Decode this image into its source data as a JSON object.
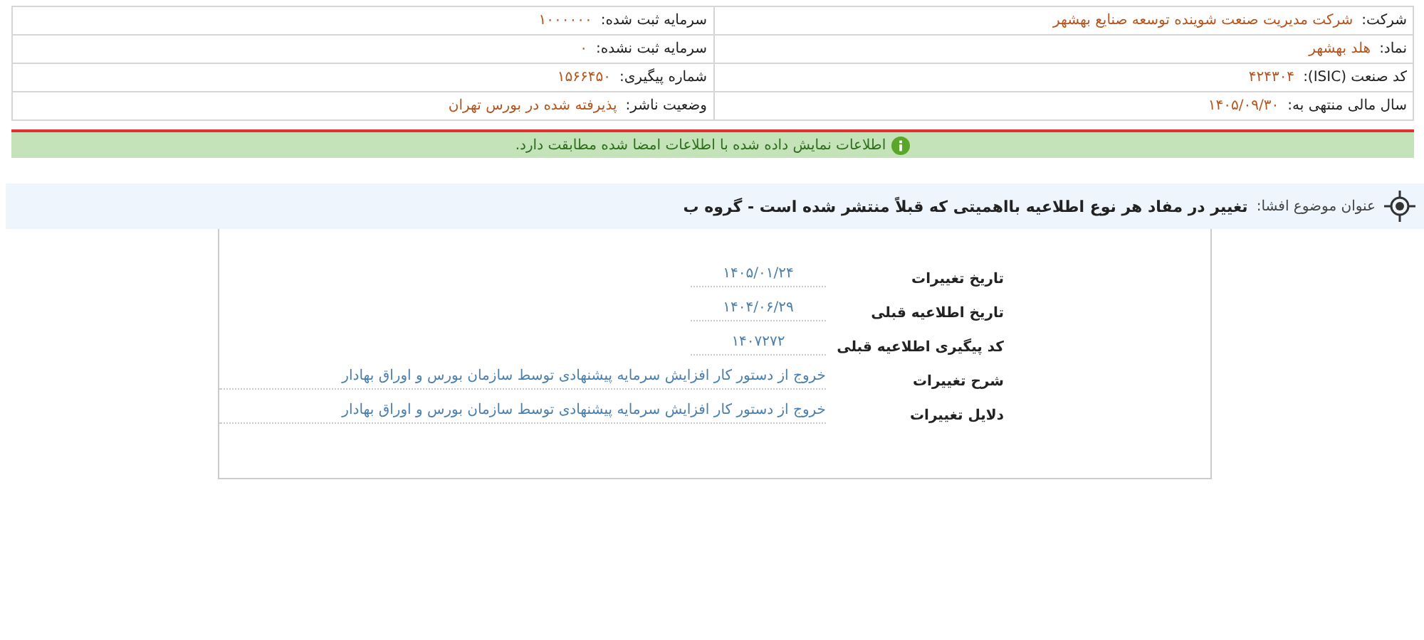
{
  "info_table": {
    "rows": [
      {
        "right": {
          "label": "شرکت:",
          "value": "شرکت مدیریت صنعت شوینده توسعه صنایع بهشهر"
        },
        "left": {
          "label": "سرمایه ثبت شده:",
          "value": "۱۰۰۰۰۰۰"
        }
      },
      {
        "right": {
          "label": "نماد:",
          "value": "هلد بهشهر"
        },
        "left": {
          "label": "سرمایه ثبت نشده:",
          "value": "۰"
        }
      },
      {
        "right": {
          "label": "کد صنعت (ISIC):",
          "value": "۴۲۴۳۰۴"
        },
        "left": {
          "label": "شماره پیگیری:",
          "value": "۱۵۶۶۴۵۰"
        }
      },
      {
        "right": {
          "label": "سال مالی منتهی به:",
          "value": "۱۴۰۵/۰۹/۳۰"
        },
        "left": {
          "label": "وضعیت ناشر:",
          "value": "پذیرفته شده در بورس تهران"
        }
      }
    ]
  },
  "notice": {
    "text": "اطلاعات نمایش داده شده با اطلاعات امضا شده مطابقت دارد."
  },
  "disclosure": {
    "subject_label": "عنوان موضوع افشا:",
    "subject": "تغییر در مفاد هر نوع اطلاعیه بااهمیتی که قبلاً منتشر شده است - گروه ب"
  },
  "details": [
    {
      "kind": "short",
      "label": "تاریخ تغییرات",
      "value": "۱۴۰۵/۰۱/۲۴"
    },
    {
      "kind": "short",
      "label": "تاریخ اطلاعیه قبلی",
      "value": "۱۴۰۴/۰۶/۲۹"
    },
    {
      "kind": "short",
      "label": "کد پیگیری اطلاعیه قبلی",
      "value": "۱۴۰۷۲۷۲"
    },
    {
      "kind": "long",
      "label": "شرح تغییرات",
      "value": "خروج از دستور کار افزایش سرمایه پیشنهادی توسط سازمان بورس و اوراق بهادار"
    },
    {
      "kind": "long",
      "label": "دلایل تغییرات",
      "value": "خروج از دستور کار افزایش سرمایه پیشنهادی توسط سازمان بورس و اوراق بهادار"
    }
  ]
}
